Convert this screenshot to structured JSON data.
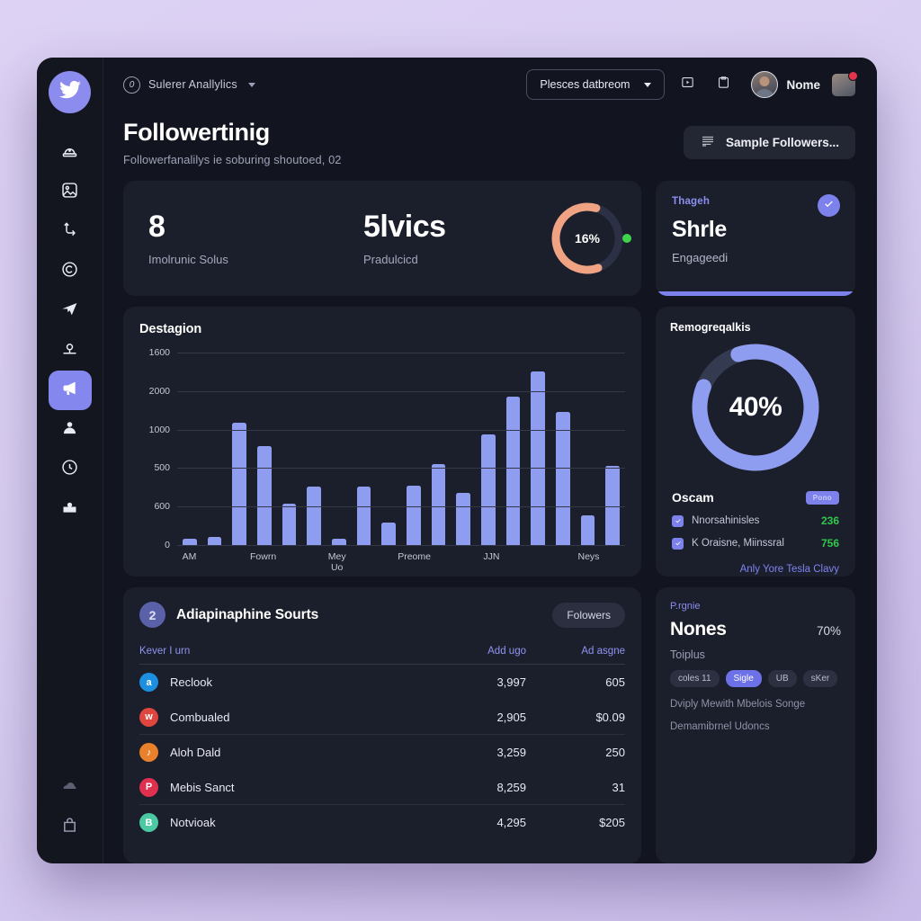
{
  "window": {
    "background_accent": "#d9cff2",
    "surface": "#12141f",
    "card": "#1b1e2b",
    "accent": "#8487ee"
  },
  "sidebar": {
    "brand_icon": "twitter-bird-icon",
    "items": [
      {
        "icon": "siren-icon",
        "active": false
      },
      {
        "icon": "image-icon",
        "active": false
      },
      {
        "icon": "flow-branch-icon",
        "active": false
      },
      {
        "icon": "copyright-circle-icon",
        "active": false
      },
      {
        "icon": "send-plane-icon",
        "active": false
      },
      {
        "icon": "location-pin-icon",
        "active": false
      },
      {
        "icon": "megaphone-icon",
        "active": true
      },
      {
        "icon": "user-icon",
        "active": false
      },
      {
        "icon": "clock-circle-icon",
        "active": false
      },
      {
        "icon": "inbox-icon",
        "active": false
      }
    ],
    "bottom_items": [
      {
        "icon": "cloud-stack-icon"
      },
      {
        "icon": "bag-icon"
      }
    ]
  },
  "topbar": {
    "workspace_badge": "0",
    "workspace_name": "Sulerer Anallylics",
    "dropdown_label": "Plesces datbreom",
    "icons": [
      {
        "name": "play-box-icon"
      },
      {
        "name": "clipboard-icon"
      }
    ],
    "user_name": "Nome",
    "avatar": "user-avatar",
    "notification_badge": true
  },
  "page": {
    "title": "Followertinig",
    "subtitle": "Followerfanalilys ie soburing shoutoed, 02",
    "action_label": "Sample Followers...",
    "action_icon": "list-lines-icon"
  },
  "kpi_card": {
    "left": {
      "value": "8",
      "label": "Imolrunic Solus"
    },
    "right": {
      "value": "5lvics",
      "label": "Pradulcicd"
    },
    "gauge": {
      "percent_label": "16%",
      "percent": 16,
      "arc_color": "#f0a383",
      "track_color": "#2b3044",
      "dot_color": "#3fd44b"
    }
  },
  "status_card": {
    "kicker": "Thageh",
    "title": "Shrle",
    "subtitle": "Engageedi",
    "check_icon": "check-circle-icon",
    "bar_color": "#7d81ec"
  },
  "chart_card": {
    "title": "Destagion"
  },
  "chart_data": {
    "type": "bar",
    "title": "Destagion",
    "xlabel": "",
    "ylabel": "",
    "grid": true,
    "legend": null,
    "ytick_labels": [
      "1600",
      "2000",
      "1000",
      "500",
      "600",
      "0"
    ],
    "ytick_positions": [
      0.0,
      0.2,
      0.4,
      0.6,
      0.8,
      1.0
    ],
    "xtick_labels": [
      "AM",
      "Fowrn",
      "Mey Uo",
      "Preome",
      "JJN",
      "Neys"
    ],
    "xtick_slots": [
      0,
      3,
      6,
      9,
      12,
      16
    ],
    "bar_color": "#8e9df0",
    "categories": [
      "1",
      "2",
      "3",
      "4",
      "5",
      "6",
      "7",
      "8",
      "9",
      "10",
      "11",
      "12",
      "13",
      "14",
      "15",
      "16",
      "17",
      "18"
    ],
    "values": [
      18,
      22,
      330,
      268,
      112,
      158,
      16,
      158,
      60,
      160,
      220,
      140,
      300,
      400,
      470,
      360,
      80,
      215
    ],
    "ylim": [
      0,
      520
    ]
  },
  "donut_card": {
    "title": "Remogreqalkis",
    "percent": 40,
    "percent_label": "40%",
    "ring_color": "#8e9df0",
    "track_color": "#343a4f",
    "sweep_fraction": 0.86
  },
  "checklist": {
    "title": "Oscam",
    "pill": "Pono",
    "items": [
      {
        "label": "Nnorsahinisles",
        "value": "236",
        "checked": true
      },
      {
        "label": "K Oraisne, Miinssral",
        "value": "756",
        "checked": true
      }
    ],
    "footer": "Anly Yore Tesla Clavy"
  },
  "table_card": {
    "badge": "2",
    "title": "Adiapinaphine Sourts",
    "tab": "Folowers",
    "columns": [
      "Kever I urn",
      "Add ugo",
      "Ad asgne"
    ],
    "rows": [
      {
        "icon_letter": "a",
        "icon_color": "#1d8fe0",
        "icon_name": "twitter-round-icon",
        "name": "Reclook",
        "a": "3,997",
        "b": "605",
        "sep": false
      },
      {
        "icon_letter": "w",
        "icon_color": "#e0453f",
        "icon_name": "wordpress-round-icon",
        "name": "Combualed",
        "a": "2,905",
        "b": "$0.09",
        "sep": true
      },
      {
        "icon_letter": "♪",
        "icon_color": "#e8802c",
        "icon_name": "music-round-icon",
        "name": "Aloh Dald",
        "a": "3,259",
        "b": "250",
        "sep": false
      },
      {
        "icon_letter": "P",
        "icon_color": "#e0304f",
        "icon_name": "pinterest-round-icon",
        "name": "Mebis Sanct",
        "a": "8,259",
        "b": "31",
        "sep": true
      },
      {
        "icon_letter": "B",
        "icon_color": "#4cc8a3",
        "icon_name": "blogger-round-icon",
        "name": "Notvioak",
        "a": "4,295",
        "b": "$205",
        "sep": false
      }
    ]
  },
  "profile_card": {
    "kicker": "P.rgnie",
    "name": "Nones",
    "percent": "70%",
    "sub": "Toiplus",
    "tags": [
      {
        "label": "coles 11",
        "accent": false
      },
      {
        "label": "Sigle",
        "accent": true
      },
      {
        "label": "UB",
        "accent": false
      },
      {
        "label": "sKer",
        "accent": false
      }
    ],
    "lines": [
      "Dviply Mewith Mbelois Songe",
      "Demamibrnel Udoncs"
    ]
  }
}
